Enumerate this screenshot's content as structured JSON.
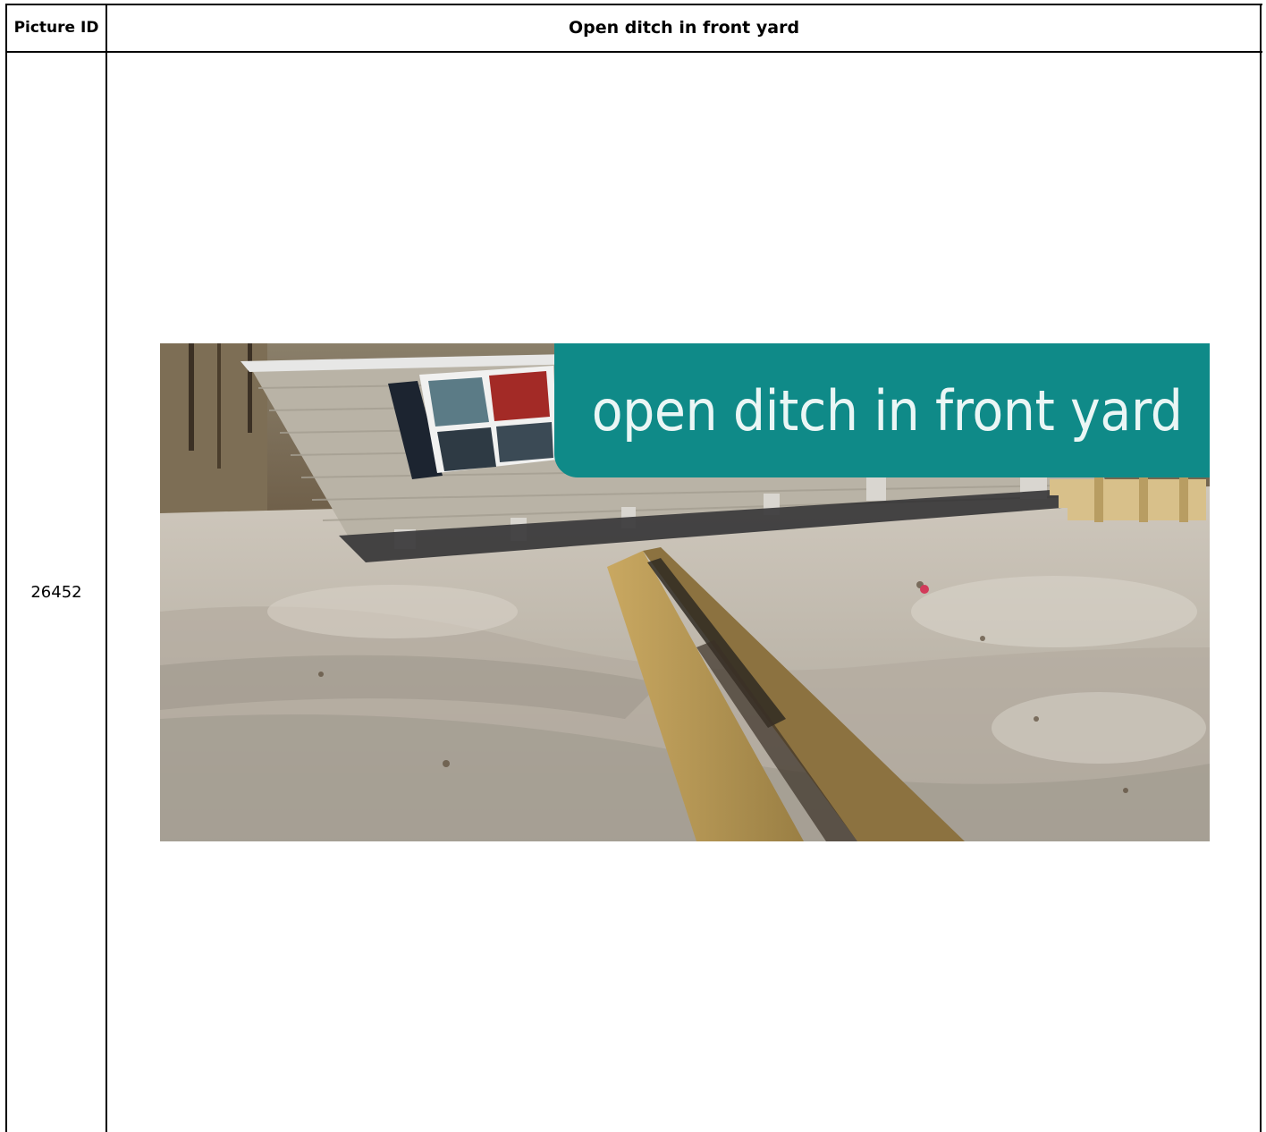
{
  "table": {
    "header": {
      "id_label": "Picture ID",
      "title": "Open ditch in front yard"
    },
    "row": {
      "picture_id": "26452",
      "photo_caption": "open ditch in front yard"
    }
  },
  "colors": {
    "border": "#000000",
    "caption_banner": "#0f8a88",
    "caption_text": "#eaf6f5"
  }
}
